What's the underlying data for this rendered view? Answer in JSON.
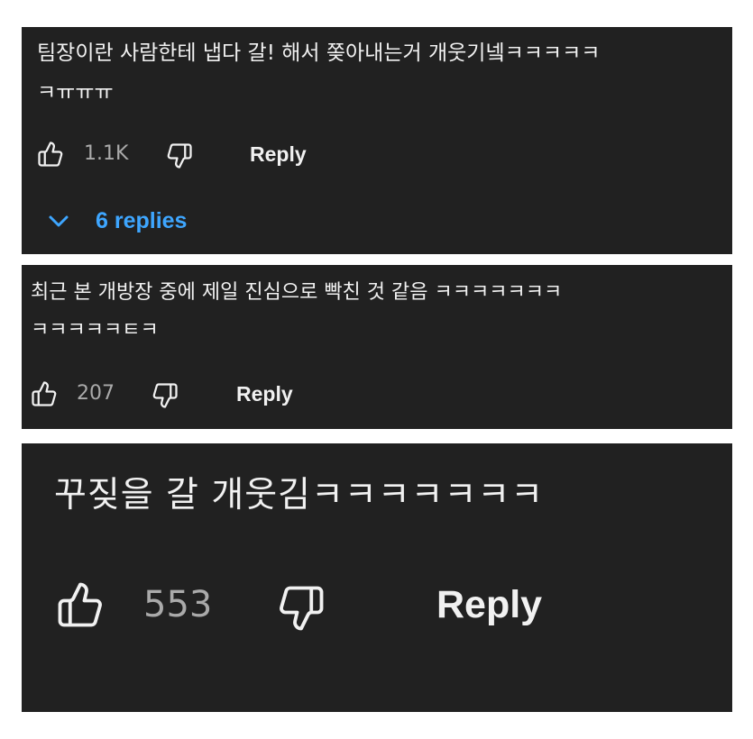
{
  "comments": [
    {
      "lines": [
        "팀장이란 사람한테 냅다 갈! 해서 쫒아내는거 개웃기넼ㅋㅋㅋㅋㅋ",
        "ㅋㅠㅠㅠ"
      ],
      "likes": "1.1K",
      "reply_label": "Reply",
      "replies_label": "6 replies"
    },
    {
      "lines": [
        "최근 본 개방장 중에 제일 진심으로 빡친 것 같음 ㅋㅋㅋㅋㅋㅋㅋ",
        "ㅋㅋㅋㅋㅋㅌㅋ"
      ],
      "likes": "207",
      "reply_label": "Reply"
    },
    {
      "lines": [
        "꾸짖을 갈 개웃김ㅋㅋㅋㅋㅋㅋㅋ"
      ],
      "likes": "553",
      "reply_label": "Reply"
    }
  ],
  "icons": {
    "like": "thumbs-up-icon",
    "dislike": "thumbs-down-icon",
    "expand": "chevron-down-icon"
  },
  "colors": {
    "card_background": "#212121",
    "text": "#f1f1f1",
    "secondary_text": "#aaaaaa",
    "link": "#3ea6ff"
  }
}
